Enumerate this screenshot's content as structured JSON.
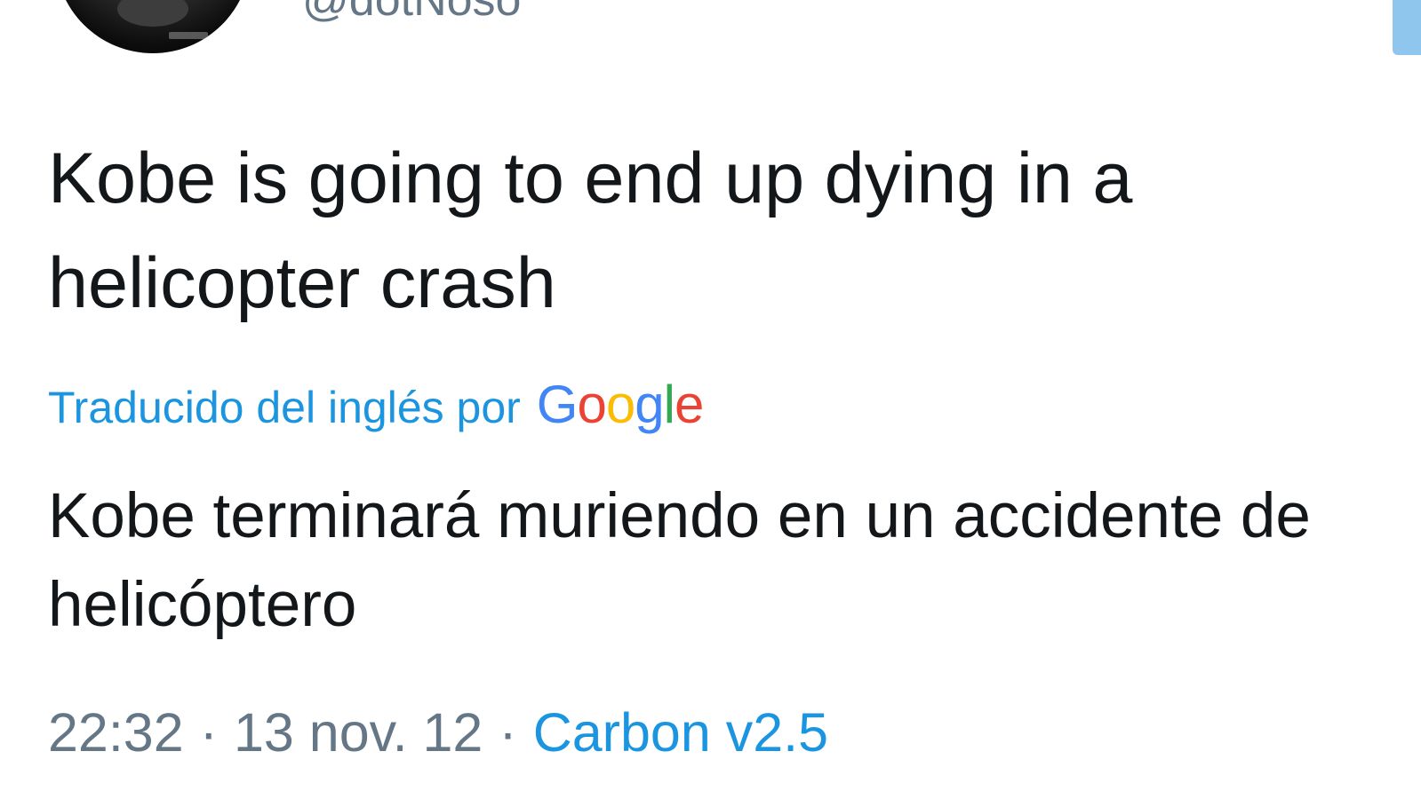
{
  "author": {
    "handle": "@dotNoso"
  },
  "tweet": {
    "text": "Kobe is going to end up dying in a helicopter crash"
  },
  "translation": {
    "label": "Traducido del inglés por",
    "provider": "Google",
    "provider_letters": [
      {
        "char": "G",
        "color": "#4285F4"
      },
      {
        "char": "o",
        "color": "#EA4335"
      },
      {
        "char": "o",
        "color": "#FBBC05"
      },
      {
        "char": "g",
        "color": "#4285F4"
      },
      {
        "char": "l",
        "color": "#34A853"
      },
      {
        "char": "e",
        "color": "#EA4335"
      }
    ],
    "text": "Kobe terminará muriendo en un accidente de helicóptero"
  },
  "meta": {
    "time": "22:32",
    "separator": "·",
    "date": "13 nov. 12",
    "source": "Carbon v2.5"
  },
  "colors": {
    "link": "#1b95e0",
    "secondary_text": "#657786",
    "primary_text": "#14171a"
  }
}
